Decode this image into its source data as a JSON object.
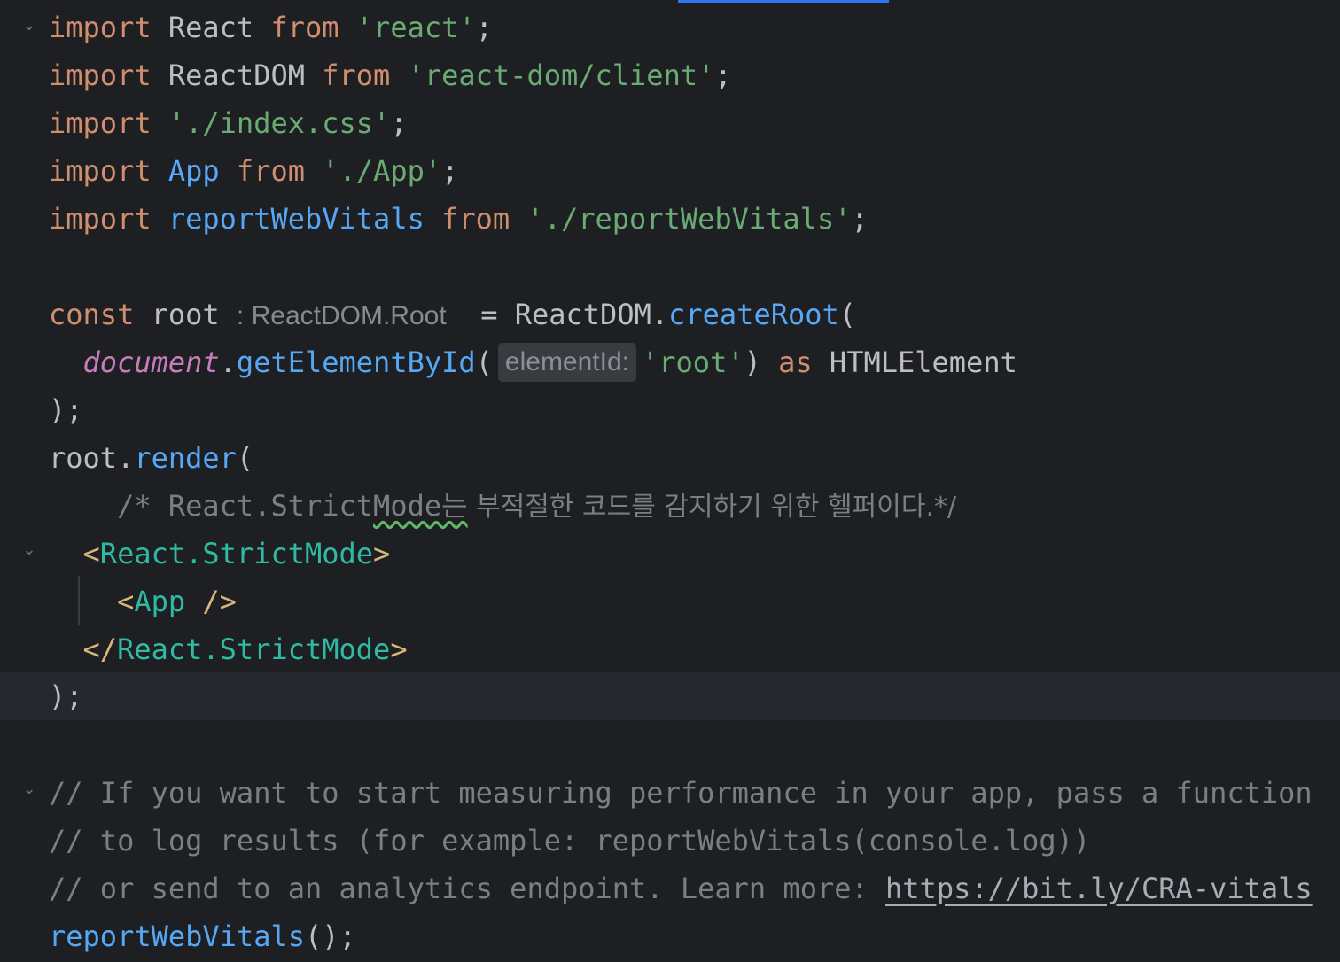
{
  "code": {
    "l1": {
      "kw1": "import",
      "id": "React",
      "kw2": "from",
      "str": "'react'",
      "end": ";"
    },
    "l2": {
      "kw1": "import",
      "id": "ReactDOM",
      "kw2": "from",
      "str": "'react-dom/client'",
      "end": ";"
    },
    "l3": {
      "kw1": "import",
      "str": "'./index.css'",
      "end": ";"
    },
    "l4": {
      "kw1": "import",
      "id": "App",
      "kw2": "from",
      "str": "'./App'",
      "end": ";"
    },
    "l5": {
      "kw1": "import",
      "id": "reportWebVitals",
      "kw2": "from",
      "str": "'./reportWebVitals'",
      "end": ";"
    },
    "l7": {
      "kw": "const",
      "id": "root",
      "type_hint": ": ReactDOM.Root",
      "eq": "=",
      "obj": "ReactDOM",
      "dot": ".",
      "fn": "createRoot",
      "paren": "("
    },
    "l8": {
      "global": "document",
      "dot": ".",
      "fn": "getElementById",
      "paren": "(",
      "param_hint": "elementId:",
      "str": "'root'",
      "close": ")",
      "kw": "as",
      "type": "HTMLElement"
    },
    "l9": {
      "text": ");"
    },
    "l10": {
      "id": "root",
      "dot": ".",
      "fn": "render",
      "paren": "("
    },
    "l11": {
      "comment_a": "/* React.Strict",
      "comment_b": "Mode는",
      "comment_c": " 부적절한 코드를 감지하기 위한 헬퍼이다.*/"
    },
    "l12": {
      "open": "<",
      "tag": "React.StrictMode",
      "close": ">"
    },
    "l13": {
      "open": "<",
      "tag": "App",
      "close": " />"
    },
    "l14": {
      "open": "</",
      "tag": "React.StrictMode",
      "close": ">"
    },
    "l15": {
      "text": ");"
    },
    "l17": {
      "comment": "// If you want to start measuring performance in your app, pass a function"
    },
    "l18": {
      "comment": "// to log results (for example: reportWebVitals(console.log))"
    },
    "l19": {
      "comment": "// or send to an analytics endpoint. Learn more: ",
      "link": "https://bit.ly/CRA-vitals"
    },
    "l20": {
      "fn": "reportWebVitals",
      "end": "();"
    }
  }
}
